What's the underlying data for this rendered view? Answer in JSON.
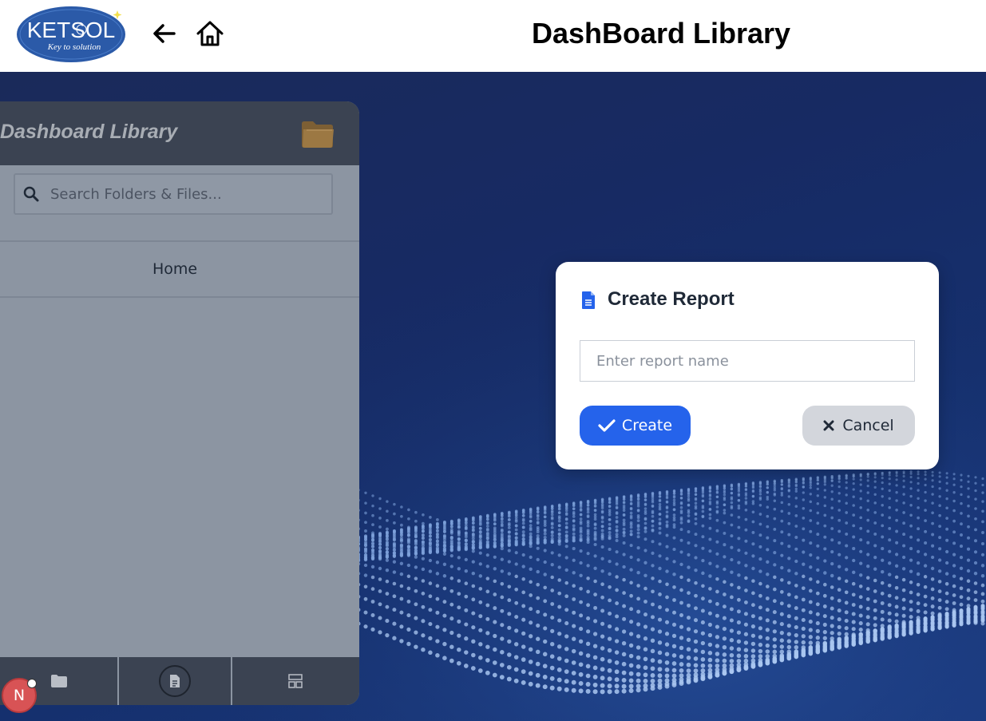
{
  "header": {
    "logo_text": "KETSOL",
    "logo_tagline": "Key to solution",
    "title": "DashBoard Library"
  },
  "library": {
    "title": "Dashboard Library",
    "search_placeholder": "Search Folders & Files...",
    "home_label": "Home"
  },
  "avatar": {
    "initial": "N",
    "color": "#d85355"
  },
  "dialog": {
    "title": "Create Report",
    "input_placeholder": "Enter report name",
    "input_value": "",
    "create_label": "Create",
    "cancel_label": "Cancel"
  },
  "colors": {
    "accent": "#2563eb",
    "panel": "#8c95a2",
    "panel_header": "#3b4352",
    "background": "#172a63"
  },
  "icons": [
    "arrow-left-icon",
    "home-icon",
    "folder-icon",
    "search-icon",
    "document-icon",
    "check-icon",
    "close-icon",
    "layout-icon"
  ]
}
